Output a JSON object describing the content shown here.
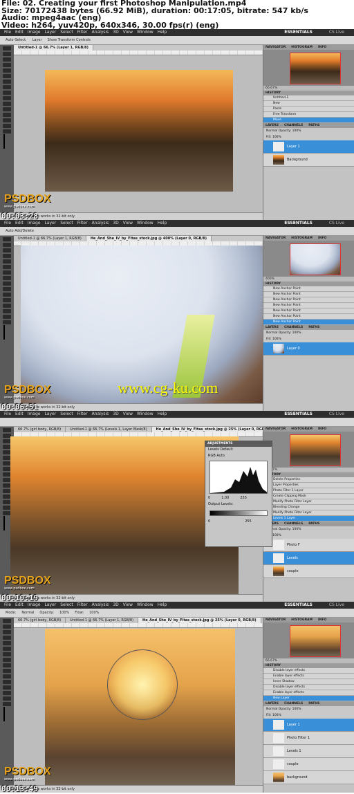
{
  "header": {
    "lines": [
      "File: 02. Creating your first Photoshop Manipulation.mp4",
      "Size: 70172438 bytes (66.92 MiB), duration: 00:17:05, bitrate: 547 kb/s",
      "Audio: mpeg4aac (eng)",
      "Video: h264, yuv420p, 640x346, 30.00 fps(r) (eng)"
    ]
  },
  "app": {
    "menu": [
      "File",
      "Edit",
      "Image",
      "Layer",
      "Select",
      "Filter",
      "Analysis",
      "3D",
      "View",
      "Window",
      "Help"
    ],
    "workspace": "ESSENTIALS",
    "cs_live": "CS Live",
    "status_text": "Exposure works in 32-bit only",
    "panel_tabs": [
      "NAVIGATOR",
      "HISTOGRAM",
      "INFO"
    ],
    "history_tab": "HISTORY",
    "layers_tabs": [
      "LAYERS",
      "CHANNELS",
      "PATHS"
    ],
    "blend_mode": "Normal",
    "opacity_label": "Opacity: 100%",
    "fill_label": "Fill: 100%",
    "logo": "PSDBOX",
    "logo_url": "www.psdbox.com"
  },
  "frames": [
    {
      "timestamp": "00:03:28",
      "options": [
        "Auto-Select:",
        "Layer",
        "Show Transform Controls"
      ],
      "tabs": [
        "Untitled-1 @ 66.7% (Layer 1, RGB/8)"
      ],
      "zoom": "66.67%",
      "history": [
        "Untitled-1",
        "New",
        "Paste",
        "Free Transform",
        "Move"
      ],
      "layers": [
        "Layer 1",
        "Background"
      ]
    },
    {
      "timestamp": "00:06:51",
      "options": [
        "Auto Add/Delete"
      ],
      "tabs": [
        "Untitled-1 @ 66.7% (Layer 1, RGB/8)",
        "He_And_She_IV_by_Fitas_stock.jpg @ 400% (Layer 0, RGB/8)"
      ],
      "zoom": "400%",
      "history": [
        "New Anchor Point",
        "New Anchor Point",
        "New Anchor Point",
        "New Anchor Point",
        "New Anchor Point",
        "New Anchor Point",
        "New Anchor Point"
      ],
      "layers": [
        "Layer 0"
      ],
      "watermark": "www.cg-ku.com"
    },
    {
      "timestamp": "00:10:19",
      "options": [],
      "tabs": [
        "66.7% (girl body, RGB/8)",
        "Untitled-1 @ 66.7% (Levels 1, Layer Mask/8)",
        "He_And_She_IV_by_Fitas_stock.jpg @ 25% (Layer 0, RGB/8)"
      ],
      "zoom": "66.67%",
      "history": [
        "Delete Properties",
        "Layer Properties",
        "Photo Filter 1 Layer",
        "Create Clipping Mask",
        "Modify Photo Filter Layer",
        "Blending Change",
        "Modify Photo Filter Layer",
        "Levels 1 Layer"
      ],
      "layers": [
        "Photo F",
        "Levels",
        "couple"
      ],
      "adjustments": {
        "title": "ADJUSTMENTS",
        "name": "Levels",
        "preset": "Default",
        "channel": "RGB",
        "auto": "Auto",
        "inputs": [
          "0",
          "1.00",
          "255"
        ],
        "output_label": "Output Levels:",
        "outputs": [
          "0",
          "255"
        ]
      }
    },
    {
      "timestamp": "00:13:49",
      "options": [
        "Mode:",
        "Normal",
        "Opacity:",
        "100%",
        "Flow:",
        "100%"
      ],
      "tabs": [
        "66.7% (girl body, RGB/8)",
        "Untitled-1 @ 66.7% (Layer 1, RGB/8)",
        "He_And_She_IV_by_Fitas_stock.jpg @ 25% (Layer 0, RGB/8)"
      ],
      "zoom": "66.67%",
      "history": [
        "Disable layer effects",
        "Enable layer effects",
        "Inner Shadow",
        "Disable layer effects",
        "Enable layer effects",
        "New Layer"
      ],
      "layers": [
        "Layer 1",
        "Photo Filter 1",
        "Levels 1",
        "couple",
        "background"
      ]
    }
  ]
}
